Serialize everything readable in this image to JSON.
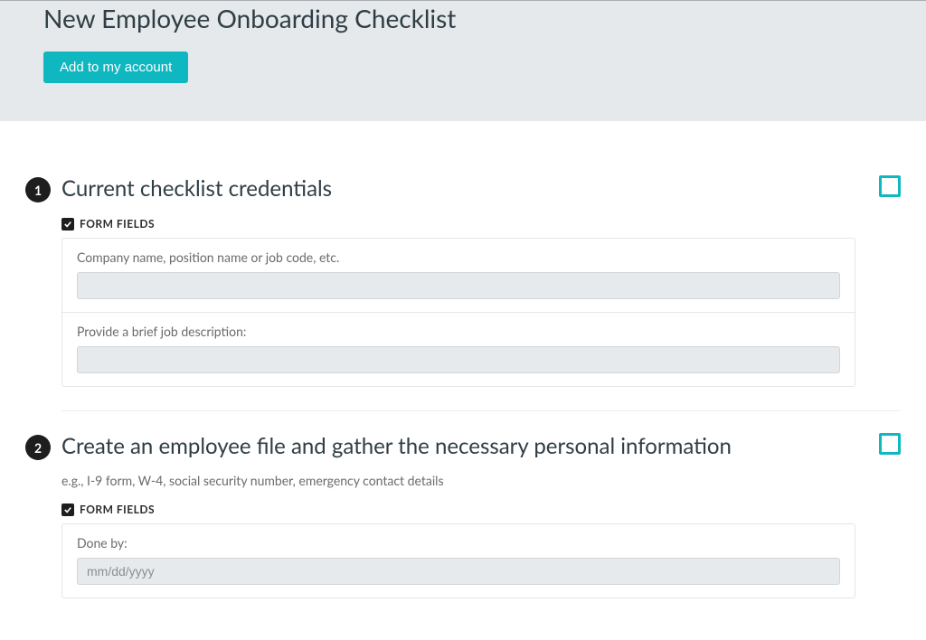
{
  "header": {
    "title": "New Employee Onboarding Checklist",
    "add_button": "Add to my account"
  },
  "form_fields_label": "FORM FIELDS",
  "steps": [
    {
      "number": "1",
      "title": "Current checklist credentials",
      "description": "",
      "fields": [
        {
          "label": "Company name, position name or job code, etc.",
          "placeholder": ""
        },
        {
          "label": "Provide a brief job description:",
          "placeholder": ""
        }
      ]
    },
    {
      "number": "2",
      "title": "Create an employee file and gather the necessary personal information",
      "description": "e.g., I-9 form, W-4, social security number, emergency contact details",
      "fields": [
        {
          "label": "Done by:",
          "placeholder": "mm/dd/yyyy"
        }
      ]
    }
  ]
}
